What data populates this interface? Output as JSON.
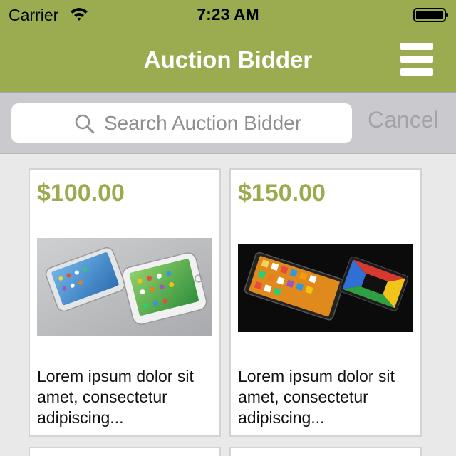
{
  "status_bar": {
    "carrier": "Carrier",
    "time": "7:23 AM"
  },
  "nav": {
    "title": "Auction Bidder",
    "menu_icon": "hamburger-menu-icon"
  },
  "search": {
    "placeholder": "Search Auction Bidder",
    "value": "",
    "cancel_label": "Cancel"
  },
  "colors": {
    "accent": "#9bab4f",
    "price": "#9bab4f",
    "search_bar_bg": "#c9c9ce",
    "page_bg": "#e9e9e9"
  },
  "items": [
    {
      "price": "$100.00",
      "image": "white-smartphones-image",
      "description": "Lorem ipsum dolor sit amet, consectetur adipiscing..."
    },
    {
      "price": "$150.00",
      "image": "black-smartphones-image",
      "description": "Lorem ipsum dolor sit amet, consectetur adipiscing..."
    }
  ]
}
